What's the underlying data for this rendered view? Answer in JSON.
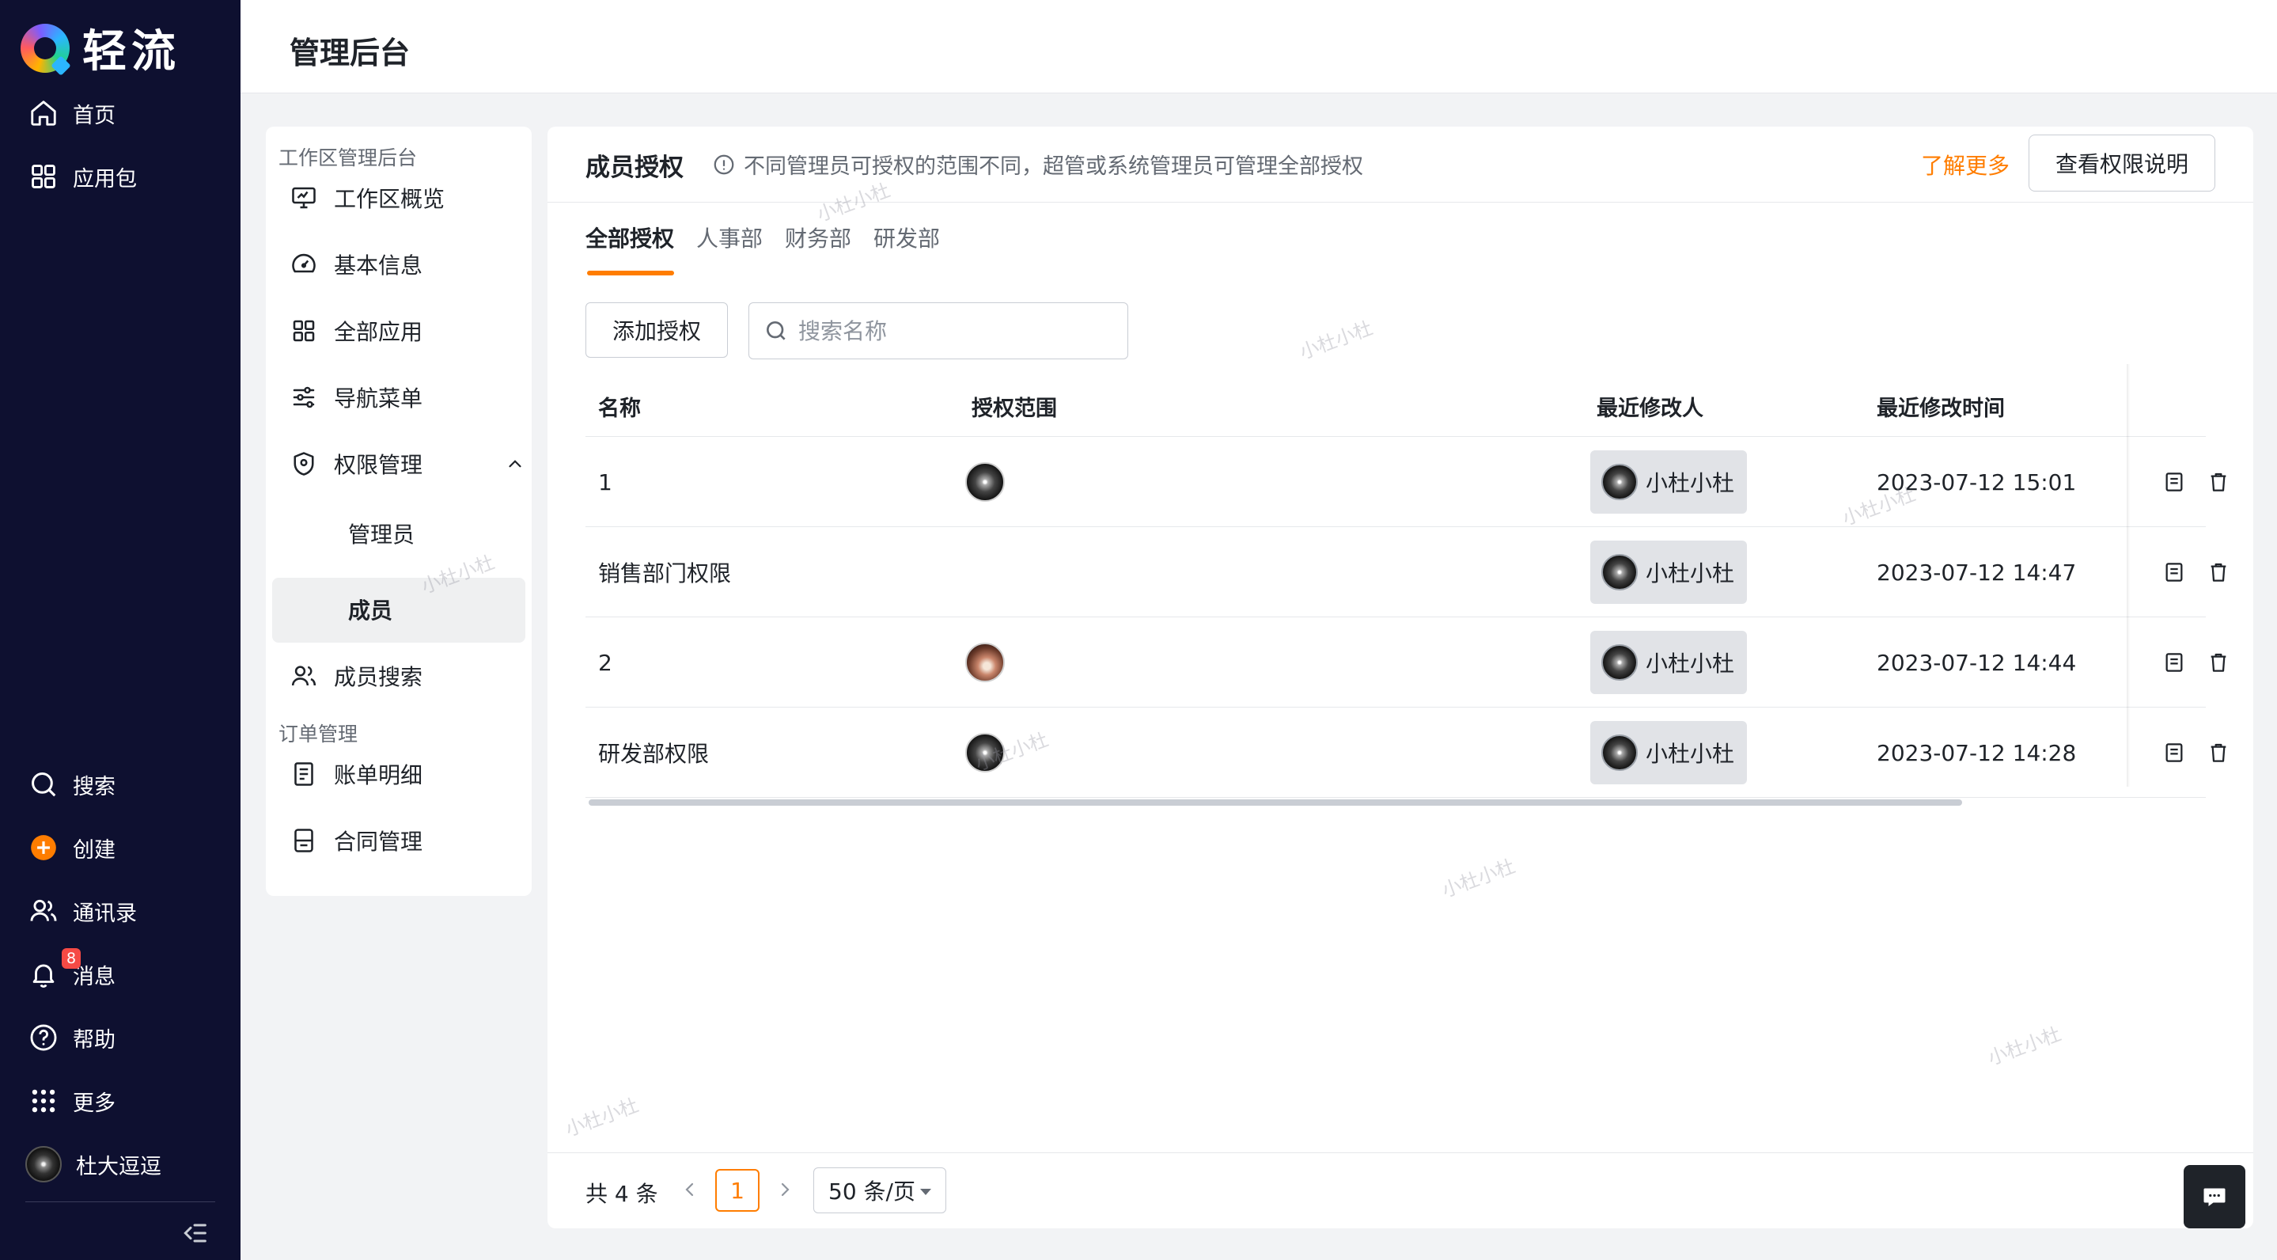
{
  "app": {
    "logo_text": "轻流"
  },
  "left_nav": {
    "top_items": [
      {
        "label": "首页",
        "icon": "home-icon"
      },
      {
        "label": "应用包",
        "icon": "grid-icon"
      }
    ],
    "bottom_items": [
      {
        "label": "搜索",
        "icon": "search-icon"
      },
      {
        "label": "创建",
        "icon": "plus-circle-icon"
      },
      {
        "label": "通讯录",
        "icon": "contacts-icon"
      },
      {
        "label": "消息",
        "icon": "bell-icon",
        "badge": "8"
      },
      {
        "label": "帮助",
        "icon": "help-icon"
      },
      {
        "label": "更多",
        "icon": "more-grid-icon"
      },
      {
        "label": "杜大逗逗",
        "icon": "avatar"
      }
    ]
  },
  "header": {
    "title": "管理后台"
  },
  "sub_nav": {
    "group_workspace": "工作区管理后台",
    "items": [
      {
        "label": "工作区概览",
        "icon": "monitor-icon"
      },
      {
        "label": "基本信息",
        "icon": "gauge-icon"
      },
      {
        "label": "全部应用",
        "icon": "apps-icon"
      },
      {
        "label": "导航菜单",
        "icon": "sliders-icon"
      },
      {
        "label": "权限管理",
        "icon": "shield-icon"
      }
    ],
    "children": [
      {
        "label": "管理员"
      },
      {
        "label": "成员"
      }
    ],
    "after_items": [
      {
        "label": "成员搜索",
        "icon": "users-icon"
      }
    ],
    "group_orders": "订单管理",
    "order_items": [
      {
        "label": "账单明细",
        "icon": "bill-icon"
      },
      {
        "label": "合同管理",
        "icon": "contract-icon"
      }
    ]
  },
  "main": {
    "title": "成员授权",
    "hint": "不同管理员可授权的范围不同，超管或系统管理员可管理全部授权",
    "learn_more": "了解更多",
    "perm_button": "查看权限说明",
    "tabs": [
      "全部授权",
      "人事部",
      "财务部",
      "研发部"
    ],
    "add_button": "添加授权",
    "search_placeholder": "搜索名称",
    "columns": {
      "name": "名称",
      "scope": "授权范围",
      "modifier": "最近修改人",
      "time": "最近修改时间"
    },
    "rows": [
      {
        "name": "1",
        "scope_avatar": "bw",
        "modifier": "小杜小杜",
        "time": "2023-07-12 15:01"
      },
      {
        "name": "销售部门权限",
        "scope_avatar": "",
        "modifier": "小杜小杜",
        "time": "2023-07-12 14:47"
      },
      {
        "name": "2",
        "scope_avatar": "photo",
        "modifier": "小杜小杜",
        "time": "2023-07-12 14:44"
      },
      {
        "name": "研发部权限",
        "scope_avatar": "bw",
        "modifier": "小杜小杜",
        "time": "2023-07-12 14:28"
      }
    ],
    "pagination": {
      "total": "共 4 条",
      "current": "1",
      "page_size": "50 条/页"
    }
  },
  "watermark": "小杜小杜",
  "colors": {
    "accent": "#ff7d00",
    "nav_bg": "#0e1030",
    "badge": "#f54a45"
  }
}
